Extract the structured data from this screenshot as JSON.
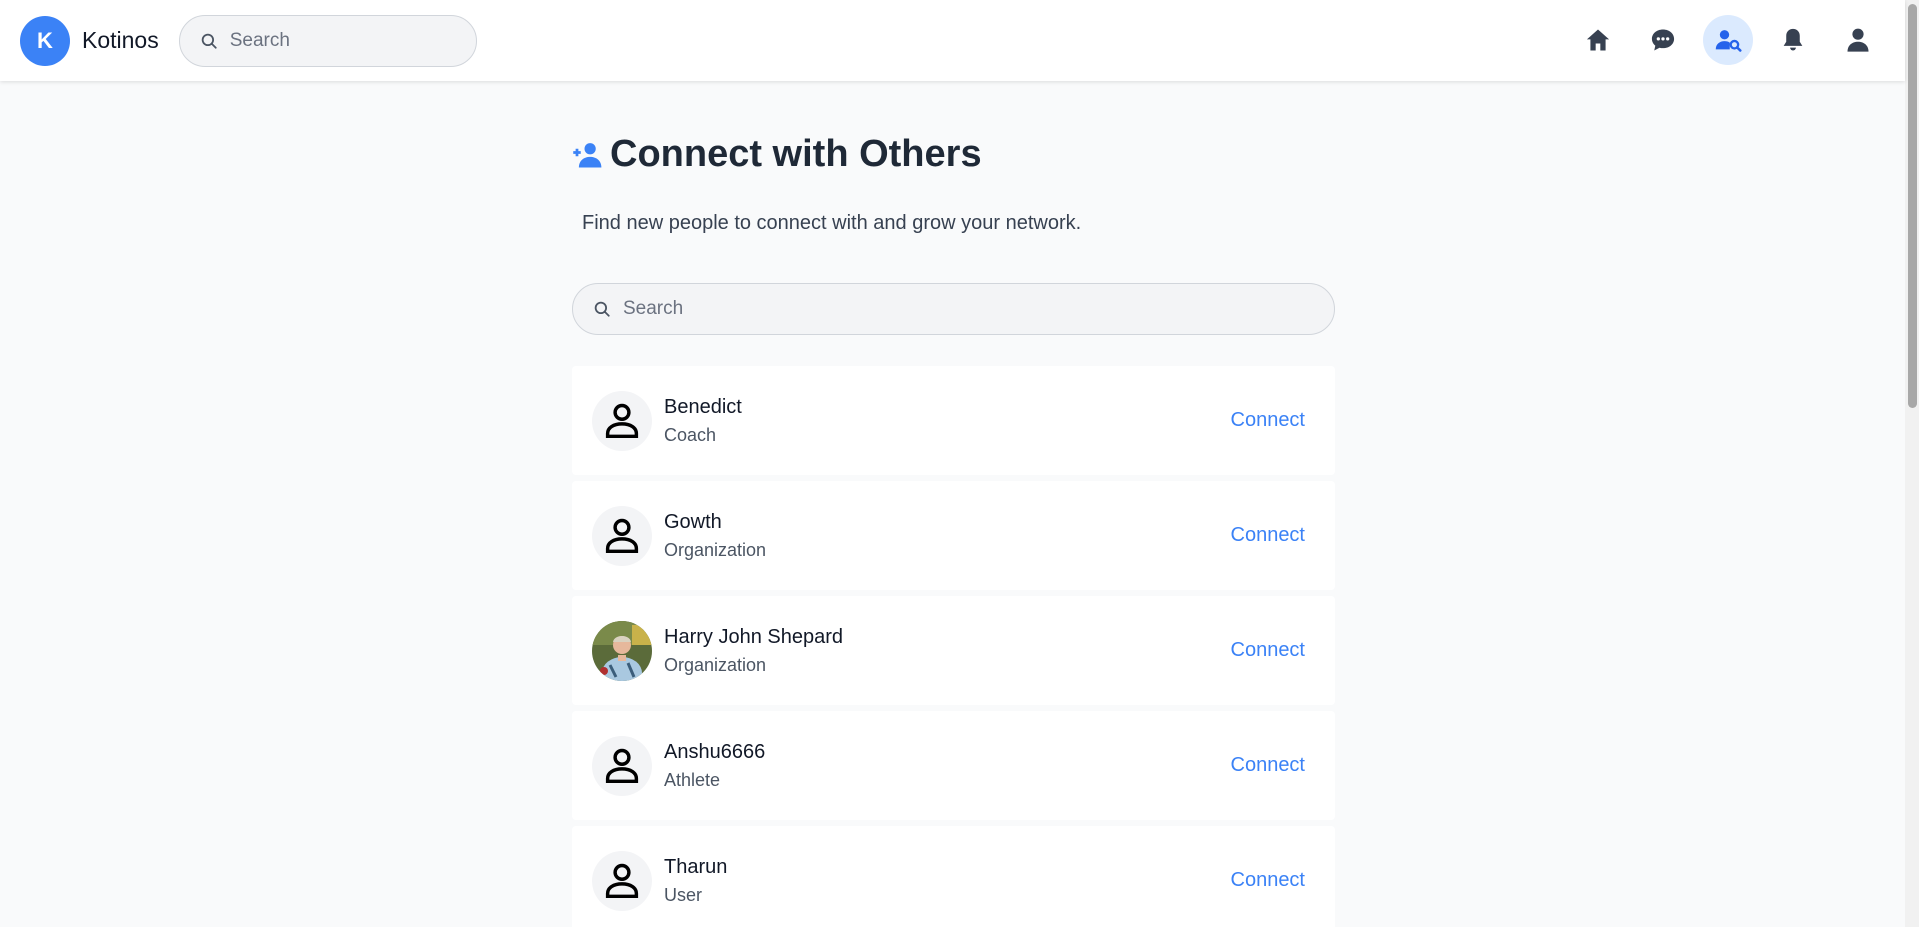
{
  "app": {
    "logo_letter": "K",
    "name": "Kotinos"
  },
  "header": {
    "search_placeholder": "Search",
    "nav": [
      "home-icon",
      "messages-icon",
      "find-people-icon",
      "notifications-icon",
      "profile-icon"
    ],
    "active_nav": "find-people-icon"
  },
  "page": {
    "title": "Connect with Others",
    "subtitle": "Find new people to connect with and grow your network.",
    "search_placeholder": "Search"
  },
  "colors": {
    "accent": "#3b82f6",
    "active_bg": "#dbeafe",
    "page_bg": "#f9fafb"
  },
  "people": [
    {
      "name": "Benedict",
      "role": "Coach",
      "action": "Connect",
      "avatar": "default-avatar-icon"
    },
    {
      "name": "Gowth",
      "role": "Organization",
      "action": "Connect",
      "avatar": "default-avatar-icon"
    },
    {
      "name": "Harry John Shepard",
      "role": "Organization",
      "action": "Connect",
      "avatar": "photo"
    },
    {
      "name": "Anshu6666",
      "role": "Athlete",
      "action": "Connect",
      "avatar": "default-avatar-icon"
    },
    {
      "name": "Tharun",
      "role": "User",
      "action": "Connect",
      "avatar": "default-avatar-icon"
    }
  ]
}
